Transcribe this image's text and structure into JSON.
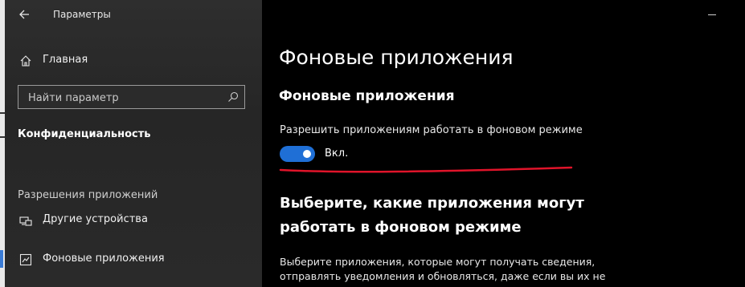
{
  "window": {
    "title": "Параметры"
  },
  "sidebar": {
    "home_label": "Главная",
    "search": {
      "placeholder": "Найти параметр"
    },
    "section_title": "Конфиденциальность",
    "group_label": "Разрешения приложений",
    "items": [
      {
        "label": "Другие устройства",
        "icon": "devices-icon"
      },
      {
        "label": "Фоновые приложения",
        "icon": "background-apps-icon"
      }
    ]
  },
  "main": {
    "title": "Фоновые приложения",
    "subtitle": "Фоновые приложения",
    "toggle": {
      "description": "Разрешить приложениям работать в фоновом режиме",
      "state_label": "Вкл.",
      "on": true
    },
    "heading": "Выберите, какие приложения могут работать в фоновом режиме",
    "body": "Выберите приложения, которые могут получать сведения, отправлять уведомления и обновляться, даже если вы их не"
  },
  "colors": {
    "accent": "#1f6fd6",
    "annotation": "#e0142a",
    "sidebar_bg": "#2b2b2b",
    "main_bg": "#000000"
  }
}
